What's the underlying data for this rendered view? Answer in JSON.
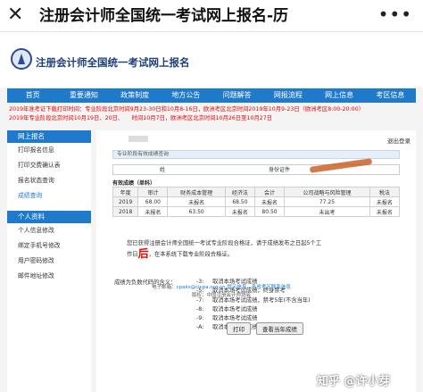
{
  "topbar": {
    "close_icon": "close-icon",
    "title": "注册会计师全国统一考试网上报名-历",
    "more_icon": "more-icon"
  },
  "header": {
    "site_title": "注册会计师全国统一考试网上报名"
  },
  "nav": [
    "首页",
    "重要通知",
    "政策制度",
    "地方公告",
    "问题解答",
    "网报流程",
    "网上信息",
    "考区信息"
  ],
  "notice": [
    "2019年准考证下载打印时间：专业阶段北京时间9月23-30日和10月8-16日，欧洲考区北京时间2019年10月9-23日（欧洲考区8:00-20:00）",
    "2019年专业阶段北京时间10月19日、20日、　　时间10月7日，欧洲考区北京时间10月26日至10月27日"
  ],
  "sidebar": {
    "section1": "网上报名",
    "items1": [
      "打印报名信息",
      "打印交费确认表",
      "报名状态查询",
      "成绩查询"
    ],
    "section2": "个人资料",
    "items2": [
      "个人信息修改",
      "绑定手机号修改",
      "用户密码修改",
      "邮件地址修改"
    ]
  },
  "main": {
    "logout": "退出登录",
    "section_title": "专业阶段有效成绩查询",
    "name_label": "姓",
    "id_label": "身份证件",
    "valid_title": "有效成绩（单科）",
    "headers": [
      "年度",
      "审计",
      "财务成本管理",
      "经济法",
      "会计",
      "公司战略与风险管理",
      "税法"
    ],
    "rows": [
      [
        "2019",
        "68.00",
        "未报名",
        "68.50",
        "未报名",
        "77.25",
        "未报名"
      ],
      [
        "2018",
        "未报名",
        "63.50",
        "未报名",
        "80.50",
        "未出考",
        "未报名"
      ]
    ],
    "congrats_1": "您已获得注册会计师全国统一考试专业阶段合格证，请于成绩发布之日起5个工",
    "congrats_2a": "作日",
    "congrats_hou": "后",
    "congrats_2b": "，在本系统下载专业阶段合格证。",
    "neg_title": "成绩为负数代码的含义：",
    "neg_codes": [
      {
        "code": "-3:",
        "text": "取消本场考试成绩"
      },
      {
        "code": "-5:",
        "text": "取消本场考试成绩，终身禁考"
      },
      {
        "code": "-7:",
        "text": "取消本场考试成绩，禁考5年(不含当年)"
      },
      {
        "code": "-8:",
        "text": "取消本场考试成绩"
      },
      {
        "code": "-9:",
        "text": "取消本场考试成绩"
      },
      {
        "code": "-A:",
        "text": "取消本场考试成绩"
      }
    ],
    "print_btn": "打印",
    "history_btn": "查看当年成绩"
  },
  "footer": {
    "line1_label": "电子邮箱：",
    "line1_email": "cpaks@cicpa.org.cn",
    "line1_rest": "提示信息，各省考区联系信息",
    "line2": "版权：中国注册会计师协会"
  },
  "watermark": "知乎 @许小芽"
}
